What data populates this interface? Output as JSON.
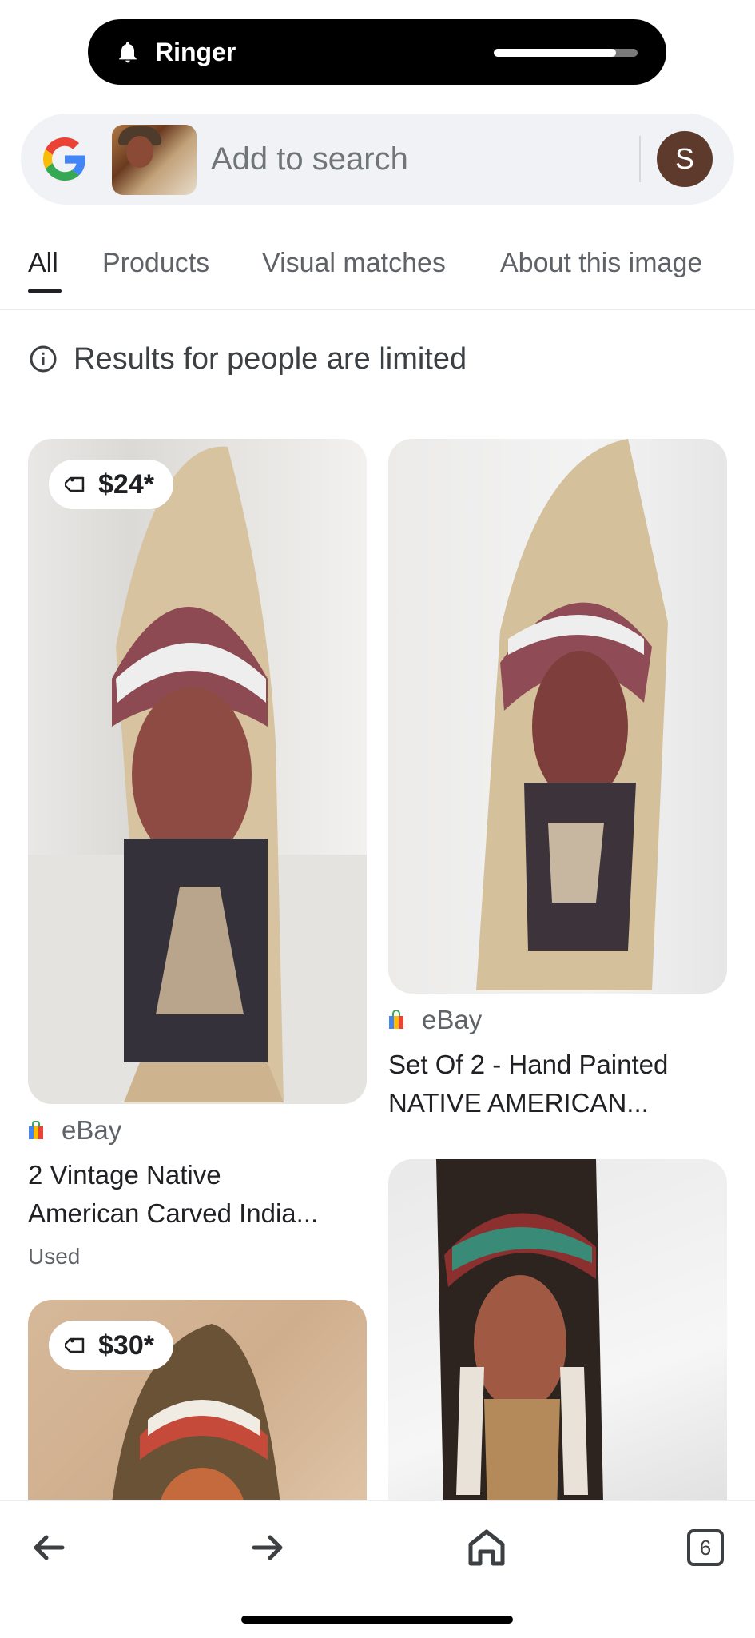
{
  "status_pill": {
    "label": "Ringer",
    "volume": 0.85
  },
  "search": {
    "placeholder": "Add to search",
    "avatar_letter": "S"
  },
  "tabs": [
    {
      "label": "All",
      "active": true
    },
    {
      "label": "Products",
      "active": false
    },
    {
      "label": "Visual matches",
      "active": false
    },
    {
      "label": "About this image",
      "active": false
    }
  ],
  "notice": {
    "text": "Results for people are limited"
  },
  "results": [
    {
      "price": "$24*",
      "source": "eBay",
      "title_line1": "2 Vintage Native",
      "title_line2": "American Carved India...",
      "condition": "Used"
    },
    {
      "source": "eBay",
      "title_line1": "Set Of 2 - Hand Painted",
      "title_line2": "NATIVE AMERICAN..."
    },
    {
      "price": "$30*"
    },
    {}
  ],
  "bottom_nav": {
    "tab_count": "6"
  },
  "colors": {
    "accent": "#202124",
    "pill_bg": "#000000",
    "searchbar_bg": "#f0f2f5",
    "avatar_bg": "#5d3a2c"
  }
}
